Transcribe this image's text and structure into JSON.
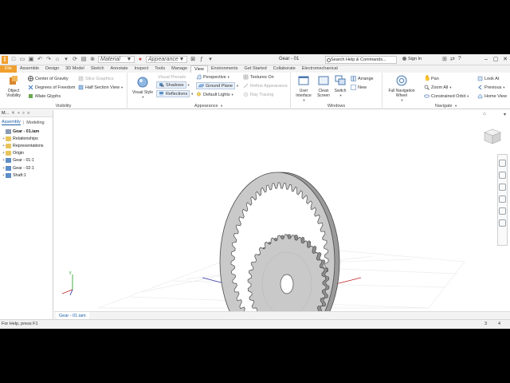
{
  "titlebar": {
    "material_placeholder": "Material",
    "appearance_placeholder": "Appearance",
    "doc_title": "Gear - 01",
    "search_placeholder": "Search Help & Commands...",
    "signin": "Sign In"
  },
  "tabs": [
    "File",
    "Assemble",
    "Design",
    "3D Model",
    "Sketch",
    "Annotate",
    "Inspect",
    "Tools",
    "Manage",
    "View",
    "Environments",
    "Get Started",
    "Collaborate",
    "Electromechanical"
  ],
  "active_tab": "View",
  "ribbon": {
    "visibility": {
      "title": "Visibility",
      "object_visibility": "Object Visibility",
      "items": [
        {
          "label": "Center of Gravity",
          "disabled": false
        },
        {
          "label": "Degrees of Freedom",
          "disabled": false
        },
        {
          "label": "iMate Glyphs",
          "disabled": false
        },
        {
          "label": "Slice Graphics",
          "disabled": true
        },
        {
          "label": "Half Section View",
          "disabled": false
        }
      ]
    },
    "appearance": {
      "title": "Appearance",
      "visual_style": "Visual Style",
      "visual_presets": "Visual Presets",
      "shadows": "Shadows",
      "reflections": "Reflections",
      "perspective": "Perspective",
      "ground_plane": "Ground Plane",
      "default_lights": "Default Lights",
      "textures_on": "Textures On",
      "refine_appearance": "Refine Appearance",
      "ray_tracing": "Ray Tracing"
    },
    "windows": {
      "title": "Windows",
      "user_interface": "User Interface",
      "clean_screen": "Clean Screen",
      "switch": "Switch",
      "arrange": "Arrange",
      "new": "New"
    },
    "navigate": {
      "title": "Navigate",
      "full_nav_wheel": "Full Navigation Wheel",
      "pan": "Pan",
      "zoom_all": "Zoom All",
      "constrained_orbit": "Constrained Orbit",
      "look_at": "Look At",
      "previous": "Previous",
      "home_view": "Home View"
    }
  },
  "browser": {
    "header": "M...",
    "tabs": [
      "Assembly",
      "Modeling"
    ],
    "nodes": [
      {
        "label": "Gear - 01.iam",
        "type": "asm",
        "root": true
      },
      {
        "label": "Relationships",
        "type": "folder"
      },
      {
        "label": "Representations",
        "type": "folder"
      },
      {
        "label": "Origin",
        "type": "folder"
      },
      {
        "label": "Gear - 01:1",
        "type": "prt"
      },
      {
        "label": "Gear - 02:1",
        "type": "prt"
      },
      {
        "label": "Shaft:1",
        "type": "prt"
      }
    ]
  },
  "doc_tab": "Gear - 01.iam",
  "status": {
    "message": "For Help, press F1",
    "count1": "3",
    "count2": "4"
  },
  "colors": {
    "file_tab": "#f0a030",
    "gear_face": "#c9c9c9",
    "gear_edge": "#4a4a4a"
  }
}
